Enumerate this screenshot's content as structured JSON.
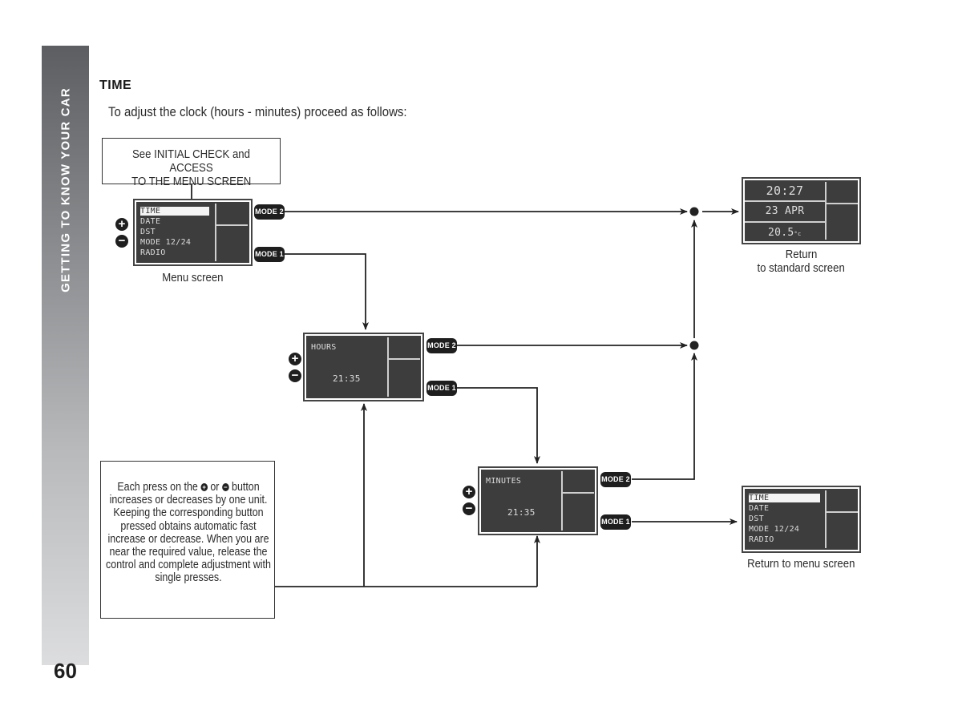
{
  "sidebar": {
    "section_title": "GETTING TO KNOW YOUR CAR",
    "page_number": "60"
  },
  "heading": "TIME",
  "intro": "To adjust the clock (hours - minutes) proceed as follows:",
  "initial_box": {
    "line1": "See INITIAL CHECK and ACCESS",
    "line2": "TO THE MENU SCREEN"
  },
  "menu_screen": {
    "items": [
      "TIME",
      "DATE",
      "DST",
      "MODE 12/24",
      "RADIO"
    ],
    "selected_index": 0,
    "caption": "Menu screen"
  },
  "hours_screen": {
    "label": "HOURS",
    "value": "21:35"
  },
  "minutes_screen": {
    "label": "MINUTES",
    "value": "21:35"
  },
  "standard_screen": {
    "time": "20:27",
    "date": "23 APR",
    "temperature": "20.5",
    "temperature_unit": "°c",
    "caption_line1": "Return",
    "caption_line2": "to standard screen"
  },
  "return_menu_screen": {
    "items": [
      "TIME",
      "DATE",
      "DST",
      "MODE 12/24",
      "RADIO"
    ],
    "caption": "Return to menu screen"
  },
  "buttons": {
    "mode1": "MODE 1",
    "mode2": "MODE 2",
    "plus": "+",
    "minus": "−"
  },
  "help_box": {
    "text_before": "Each press on the",
    "text_or": "or",
    "text_after": "button increases or decreases by one unit. Keeping the corresponding button pressed obtains automatic fast increase or decrease. When you are near the required value, release the control and complete adjustment with single presses."
  },
  "colors": {
    "lcd_background": "#3d3d3d",
    "button_fill": "#1e1e1e",
    "sidebar_top": "#5c5e61",
    "sidebar_bottom": "#dcdddf"
  }
}
